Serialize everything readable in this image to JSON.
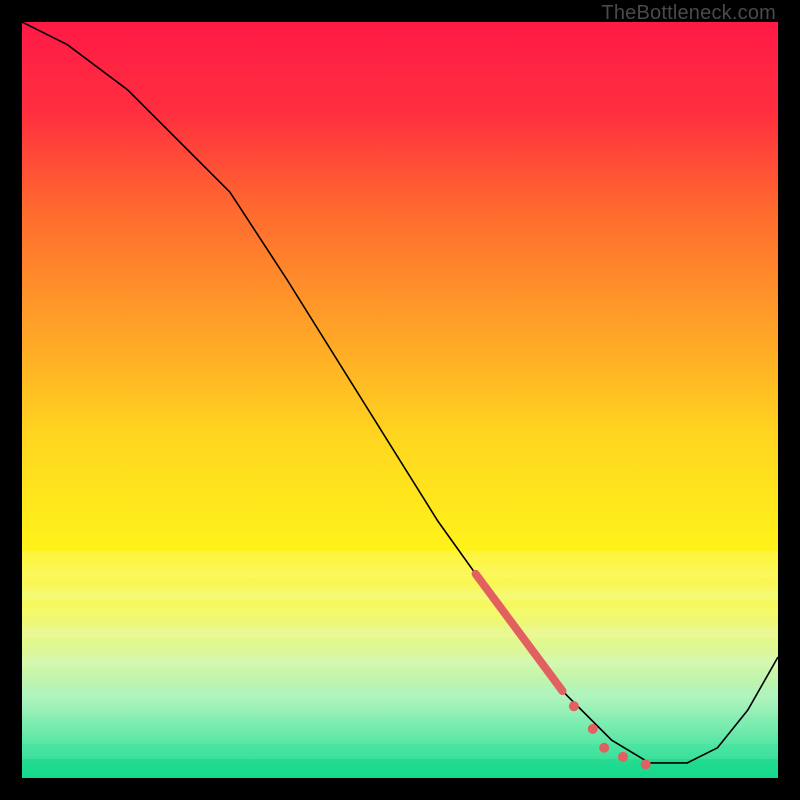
{
  "watermark": "TheBottleneck.com",
  "chart_data": {
    "type": "line",
    "title": "",
    "xlabel": "",
    "ylabel": "",
    "xlim": [
      0,
      100
    ],
    "ylim": [
      0,
      100
    ],
    "background_gradient": {
      "stops": [
        {
          "offset": 0.0,
          "color": "#ff1a46"
        },
        {
          "offset": 0.12,
          "color": "#ff2f3f"
        },
        {
          "offset": 0.25,
          "color": "#ff6a2f"
        },
        {
          "offset": 0.4,
          "color": "#ffa028"
        },
        {
          "offset": 0.55,
          "color": "#ffd61f"
        },
        {
          "offset": 0.7,
          "color": "#fff31a"
        },
        {
          "offset": 0.78,
          "color": "#f4f96a"
        },
        {
          "offset": 0.84,
          "color": "#d9f7a0"
        },
        {
          "offset": 0.9,
          "color": "#a7f2bc"
        },
        {
          "offset": 0.95,
          "color": "#5ee7a6"
        },
        {
          "offset": 1.0,
          "color": "#17d98b"
        }
      ]
    },
    "series": [
      {
        "name": "curve",
        "stroke": "#000000",
        "stroke_width": 1.6,
        "points": [
          {
            "x": 0.0,
            "y": 100.0
          },
          {
            "x": 6.0,
            "y": 97.0
          },
          {
            "x": 14.0,
            "y": 91.0
          },
          {
            "x": 22.0,
            "y": 83.0
          },
          {
            "x": 27.5,
            "y": 77.5
          },
          {
            "x": 35.0,
            "y": 66.0
          },
          {
            "x": 45.0,
            "y": 50.0
          },
          {
            "x": 55.0,
            "y": 34.0
          },
          {
            "x": 65.0,
            "y": 20.0
          },
          {
            "x": 72.0,
            "y": 11.0
          },
          {
            "x": 78.0,
            "y": 5.0
          },
          {
            "x": 83.0,
            "y": 2.0
          },
          {
            "x": 88.0,
            "y": 2.0
          },
          {
            "x": 92.0,
            "y": 4.0
          },
          {
            "x": 96.0,
            "y": 9.0
          },
          {
            "x": 100.0,
            "y": 16.0
          }
        ]
      }
    ],
    "highlight_segment": {
      "color": "#e2605f",
      "width": 8,
      "points": [
        {
          "x": 60.0,
          "y": 27.0
        },
        {
          "x": 71.5,
          "y": 11.5
        }
      ]
    },
    "highlight_dots": {
      "color": "#e2605f",
      "radius": 5,
      "points": [
        {
          "x": 73.0,
          "y": 9.5
        },
        {
          "x": 75.5,
          "y": 6.5
        },
        {
          "x": 77.0,
          "y": 4.0
        },
        {
          "x": 79.5,
          "y": 2.8
        },
        {
          "x": 82.5,
          "y": 1.8
        }
      ]
    }
  }
}
